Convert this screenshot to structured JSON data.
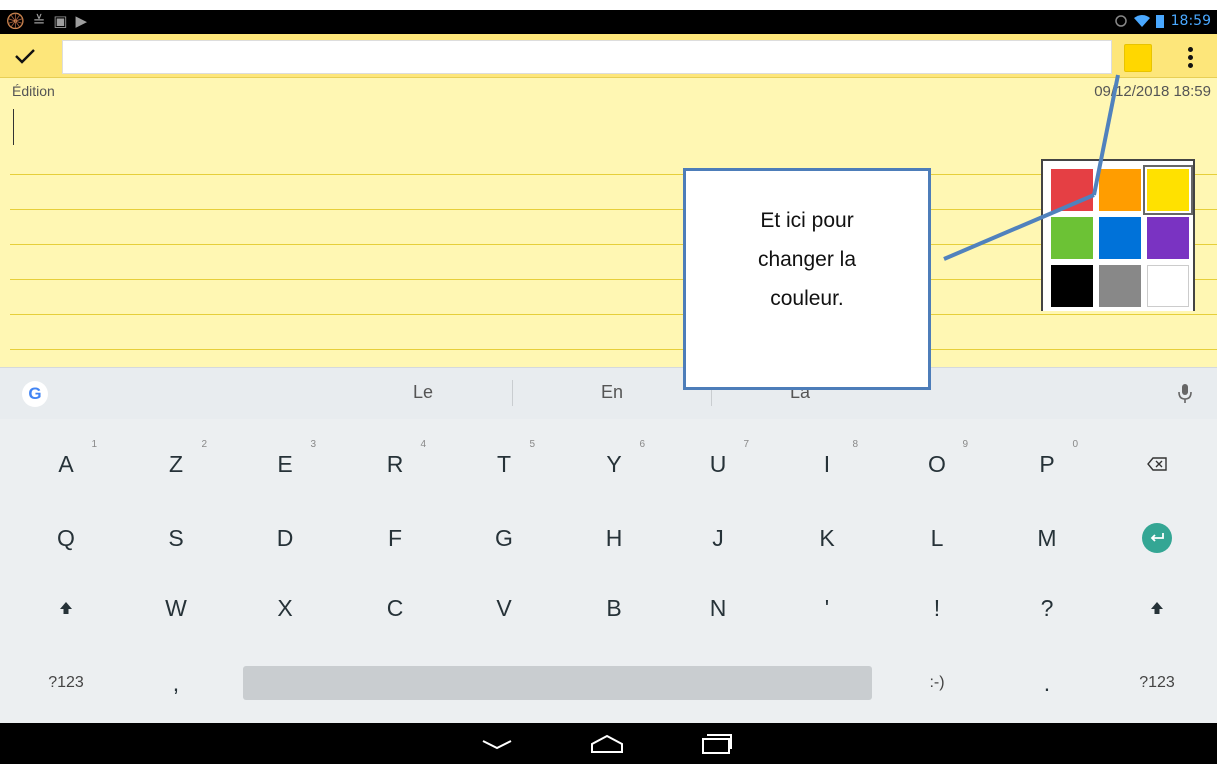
{
  "status_bar": {
    "left_icons": [
      "🛞",
      "≚",
      "▣",
      "▶"
    ],
    "left_icon_names": [
      "sync-icon",
      "download-done-icon",
      "gallery-icon",
      "play-store-icon"
    ],
    "time": "18:59"
  },
  "toolbar": {
    "title_value": "",
    "selected_color": "#ffd700"
  },
  "note": {
    "mode_label": "Édition",
    "date": "09/12/2018 18:59"
  },
  "color_picker": {
    "swatches": [
      "#e53f44",
      "#ff9d00",
      "#ffe100",
      "#6cc235",
      "#0072d9",
      "#7a33c2",
      "#000000",
      "#888888",
      "#ffffff"
    ],
    "selected_index": 2
  },
  "annotation": {
    "lines": [
      "Et ici pour",
      "changer la",
      "couleur."
    ]
  },
  "suggestions": [
    "Le",
    "En",
    "La"
  ],
  "keyboard": {
    "row1": [
      {
        "label": "A",
        "hint": "1"
      },
      {
        "label": "Z",
        "hint": "2"
      },
      {
        "label": "E",
        "hint": "3"
      },
      {
        "label": "R",
        "hint": "4"
      },
      {
        "label": "T",
        "hint": "5"
      },
      {
        "label": "Y",
        "hint": "6"
      },
      {
        "label": "U",
        "hint": "7"
      },
      {
        "label": "I",
        "hint": "8"
      },
      {
        "label": "O",
        "hint": "9"
      },
      {
        "label": "P",
        "hint": "0"
      }
    ],
    "row2": [
      "Q",
      "S",
      "D",
      "F",
      "G",
      "H",
      "J",
      "K",
      "L",
      "M"
    ],
    "row3": [
      "W",
      "X",
      "C",
      "V",
      "B",
      "N",
      "'",
      "!",
      "?"
    ],
    "row4": {
      "symbols_left": "?123",
      "comma": ",",
      "smiley": ":-)",
      "period": ".",
      "symbols_right": "?123"
    }
  },
  "colors": {
    "note_background": "#fff7b3",
    "toolbar_background": "#fde67a",
    "annotation_border": "#4d7db9",
    "enter_key": "#34a694"
  }
}
